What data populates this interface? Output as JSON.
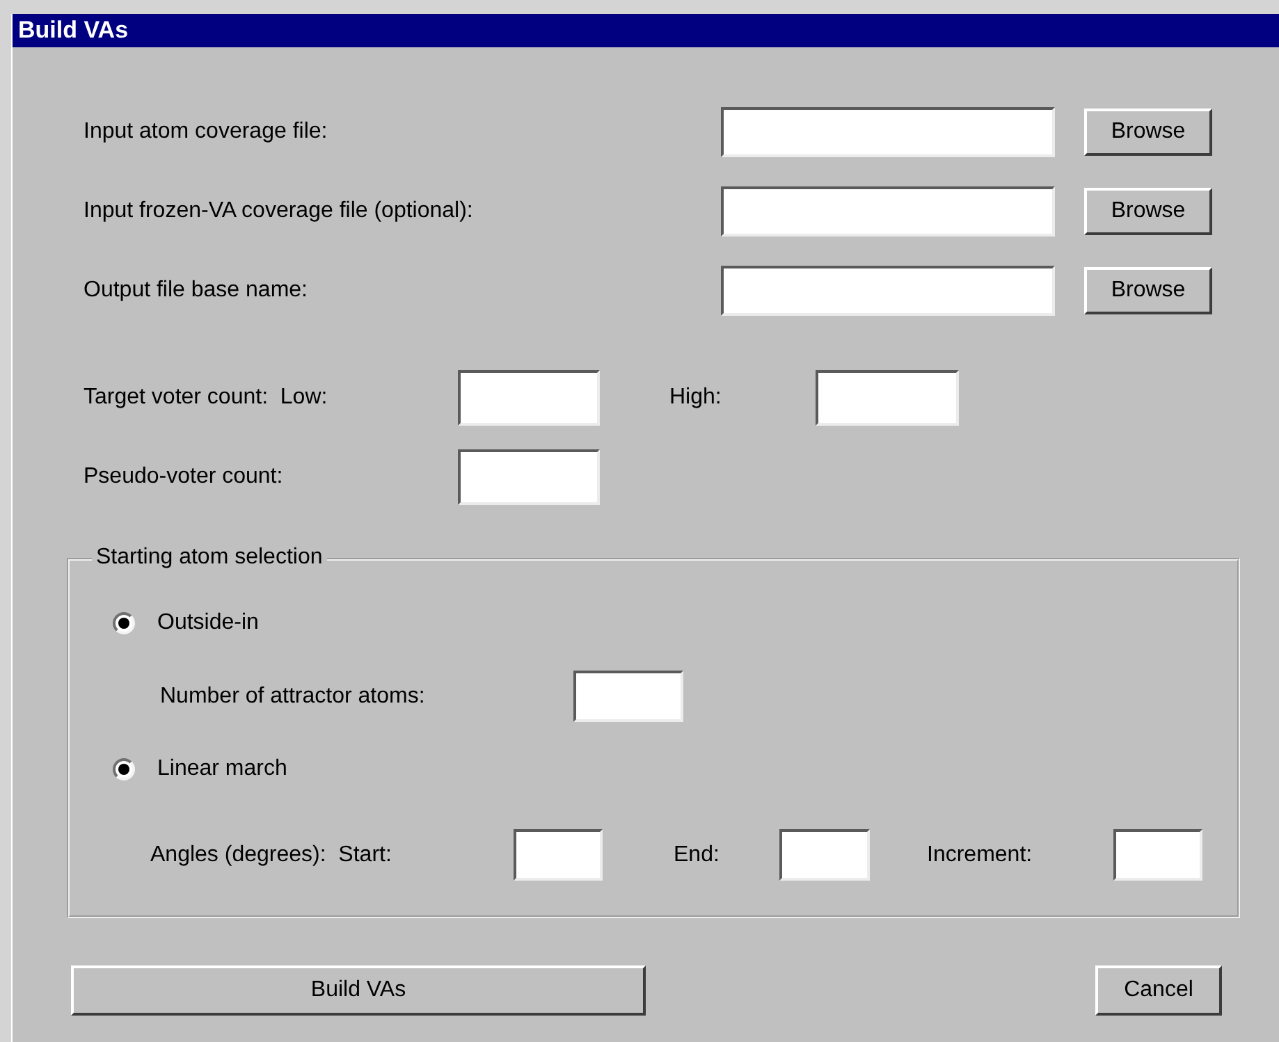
{
  "window": {
    "title": "Build VAs"
  },
  "file_rows": [
    {
      "label": "Input atom coverage file:",
      "button": "Browse"
    },
    {
      "label": "Input frozen-VA coverage file (optional):",
      "button": "Browse"
    },
    {
      "label": "Output file base name:",
      "button": "Browse"
    }
  ],
  "voter_count": {
    "label": "Target voter count:  Low:",
    "high_label": "High:"
  },
  "pseudo_voter": {
    "label": "Pseudo-voter count:"
  },
  "starting_atom_selection": {
    "title": "Starting atom selection",
    "options": [
      {
        "label": "Outside-in",
        "selected": true
      },
      {
        "label": "Linear march",
        "selected": true
      }
    ],
    "attractor_label": "Number of attractor atoms:",
    "angles": {
      "label": "Angles (degrees):  Start:",
      "end_label": "End:",
      "increment_label": "Increment:"
    }
  },
  "buttons": [
    "Build VAs",
    "Cancel"
  ]
}
